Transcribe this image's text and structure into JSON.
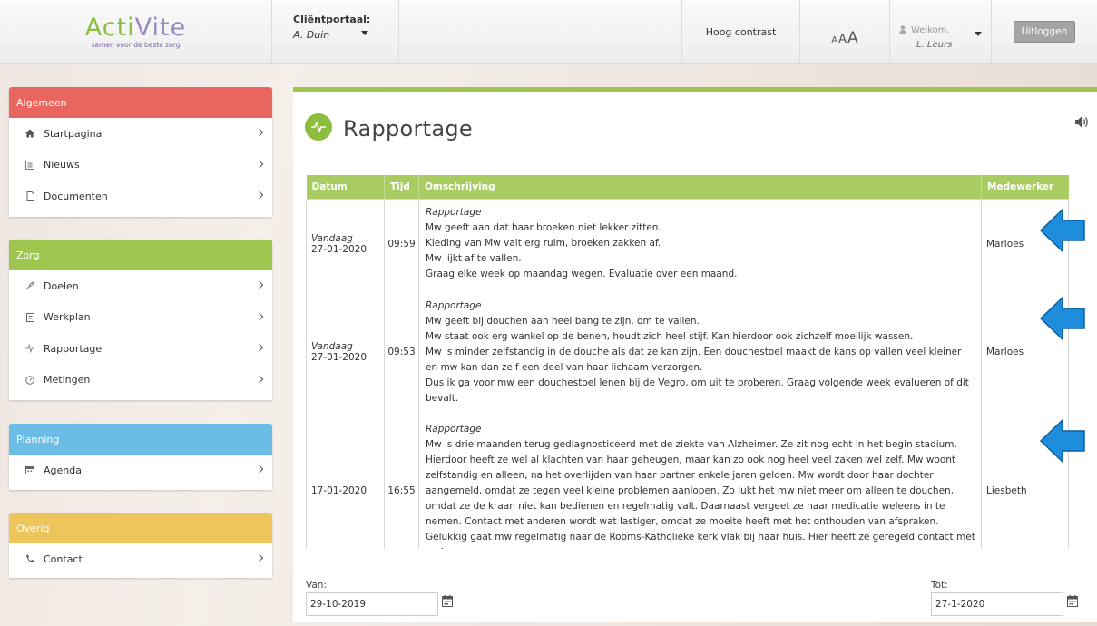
{
  "logo": {
    "word_start": "Acti",
    "word_end": "Vite",
    "tagline": "samen voor de beste zorg"
  },
  "header": {
    "portal_label": "Cliëntportaal:",
    "portal_client": "A. Duin",
    "contrast": "Hoog contrast",
    "size_small": "A",
    "size_medium": "A",
    "size_large": "A",
    "welcome": "Welkom.",
    "user_name": "L. Leurs",
    "logout": "Uitloggen"
  },
  "sidebar": {
    "sections": [
      {
        "title": "Algemeen",
        "color": "#e8665f",
        "items": [
          {
            "label": "Startpagina",
            "icon": "home-icon"
          },
          {
            "label": "Nieuws",
            "icon": "news-icon"
          },
          {
            "label": "Documenten",
            "icon": "document-icon"
          }
        ]
      },
      {
        "title": "Zorg",
        "color": "#9ec54e",
        "items": [
          {
            "label": "Doelen",
            "icon": "goals-icon"
          },
          {
            "label": "Werkplan",
            "icon": "workplan-icon"
          },
          {
            "label": "Rapportage",
            "icon": "pulse-icon"
          },
          {
            "label": "Metingen",
            "icon": "gauge-icon"
          }
        ]
      },
      {
        "title": "Planning",
        "color": "#6bbde6",
        "items": [
          {
            "label": "Agenda",
            "icon": "calendar-icon"
          }
        ]
      },
      {
        "title": "Overig",
        "color": "#edc55a",
        "items": [
          {
            "label": "Contact",
            "icon": "phone-icon"
          }
        ]
      }
    ]
  },
  "page": {
    "title": "Rapportage",
    "accent": "#9ec54e"
  },
  "table": {
    "headers": {
      "datum": "Datum",
      "tijd": "Tijd",
      "omschrijving": "Omschrijving",
      "medewerker": "Medewerker"
    },
    "rows": [
      {
        "day": "Vandaag",
        "date": "27-01-2020",
        "time": "09:59",
        "subject": "Rapportage",
        "lines": [
          "Mw geeft aan dat haar broeken niet lekker zitten.",
          "Kleding van Mw valt erg ruim, broeken zakken af.",
          "Mw lijkt af te vallen.",
          "Graag elke week op maandag wegen. Evaluatie over een maand."
        ],
        "employee": "Marloes"
      },
      {
        "day": "Vandaag",
        "date": "27-01-2020",
        "time": "09:53",
        "subject": "Rapportage",
        "lines": [
          "Mw geeft bij douchen aan heel bang te zijn, om te vallen.",
          "Mw staat ook erg wankel op de benen, houdt zich heel stijf. Kan hierdoor ook zichzelf moeilijk wassen.",
          "Mw is minder zelfstandig in de douche als dat ze kan zijn. Een douchestoel maakt de kans op vallen veel kleiner en mw kan dan zelf een deel van haar lichaam verzorgen.",
          "Dus ik ga voor mw een douchestoel lenen bij de Vegro, om uit te proberen. Graag volgende week evalueren of dit bevalt."
        ],
        "employee": "Marloes"
      },
      {
        "day": "",
        "date": "17-01-2020",
        "time": "16:55",
        "subject": "Rapportage",
        "lines": [
          "Mw is drie maanden terug gediagnosticeerd met de ziekte van Alzheimer. Ze zit nog echt in het begin stadium. Hierdoor heeft ze wel al klachten van haar geheugen, maar kan zo ook nog heel veel zaken wel zelf. Mw woont zelfstandig en alleen, na het overlijden van haar partner enkele jaren gelden. Mw wordt door haar dochter aangemeld, omdat ze tegen veel kleine problemen aanlopen. Zo lukt het mw niet meer om alleen te douchen, omdat ze de kraan niet kan bedienen en regelmatig valt. Daarnaast vergeet ze haar medicatie weleens in te nemen. Contact met anderen wordt wat lastiger, omdat ze moeite heeft met het onthouden van afspraken. Gelukkig gaat mw regelmatig naar de Rooms-Katholieke kerk vlak bij haar huis. Hier heeft ze geregeld contact met anderen."
        ],
        "employee": "Liesbeth"
      }
    ]
  },
  "filters": {
    "from_label": "Van:",
    "from_value": "29-10-2019",
    "to_label": "Tot:",
    "to_value": "27-1-2020"
  }
}
